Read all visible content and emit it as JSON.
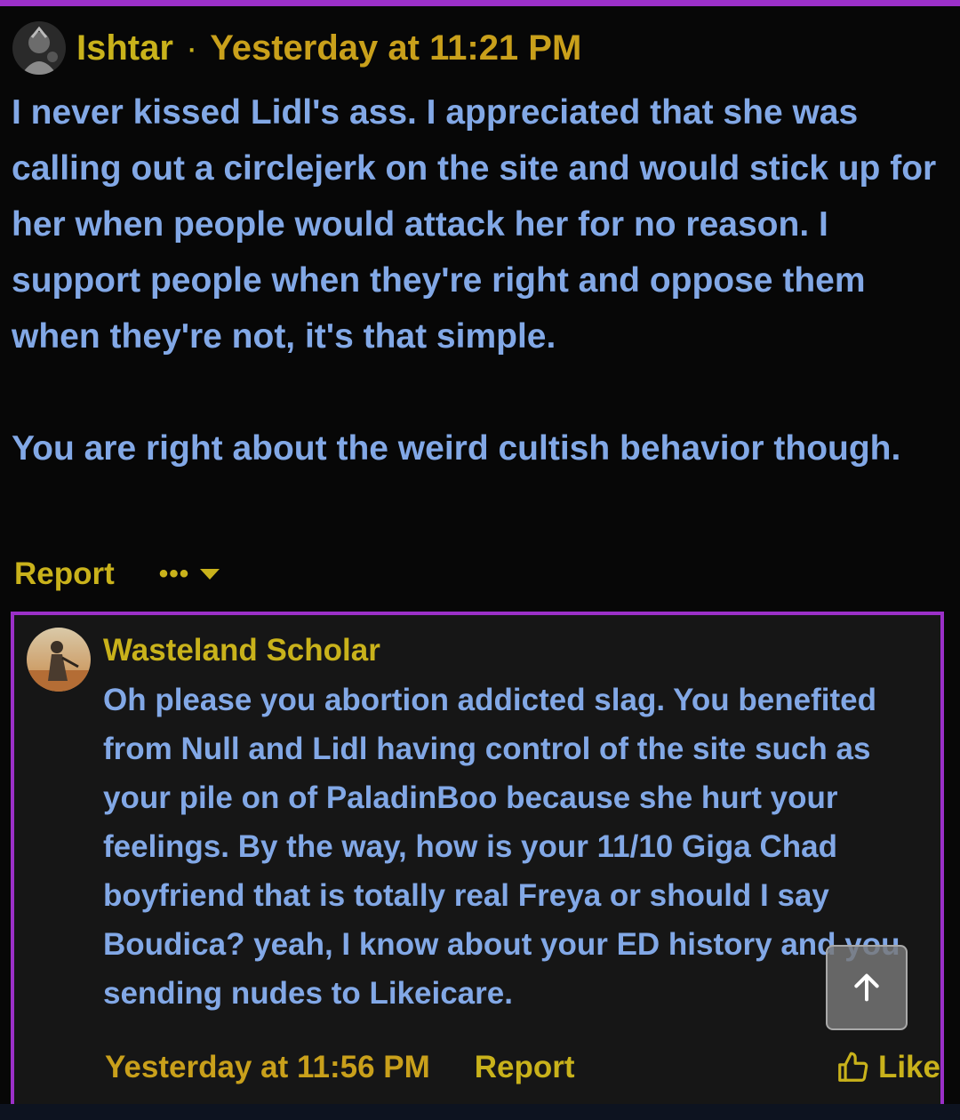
{
  "post": {
    "author": "Ishtar",
    "separator": "·",
    "timestamp": "Yesterday at 11:21 PM",
    "paragraphs": [
      "I never kissed Lidl's ass. I appreciated that she was calling out a circlejerk on the site and would stick up for her when people would attack her for no reason. I support people when they're right and oppose them when they're not, it's that simple.",
      "You are right about the weird cultish behavior though."
    ],
    "actions": {
      "report_label": "Report",
      "more_label": "•••"
    }
  },
  "reply": {
    "author": "Wasteland Scholar",
    "body": "Oh please you abortion addicted slag. You benefited from Null and Lidl having control of the site such as your pile on of PaladinBoo because she hurt your feelings. By the way, how is your 11/10 Giga Chad boyfriend that is totally real Freya or should I say Boudica? yeah, I know about your ED history and you sending nudes to Likeicare.",
    "timestamp": "Yesterday at 11:56 PM",
    "report_label": "Report",
    "like_label": "Like"
  },
  "icons": {
    "more": "ellipsis-icon",
    "caret": "caret-down-icon",
    "like": "thumbs-up-icon",
    "scroll_top": "arrow-up-icon"
  },
  "colors": {
    "accent_border": "#9b30c8",
    "username": "#c9b21b",
    "body_text": "#82a8e6",
    "page_bg": "#070707",
    "reply_bg": "#161616"
  }
}
